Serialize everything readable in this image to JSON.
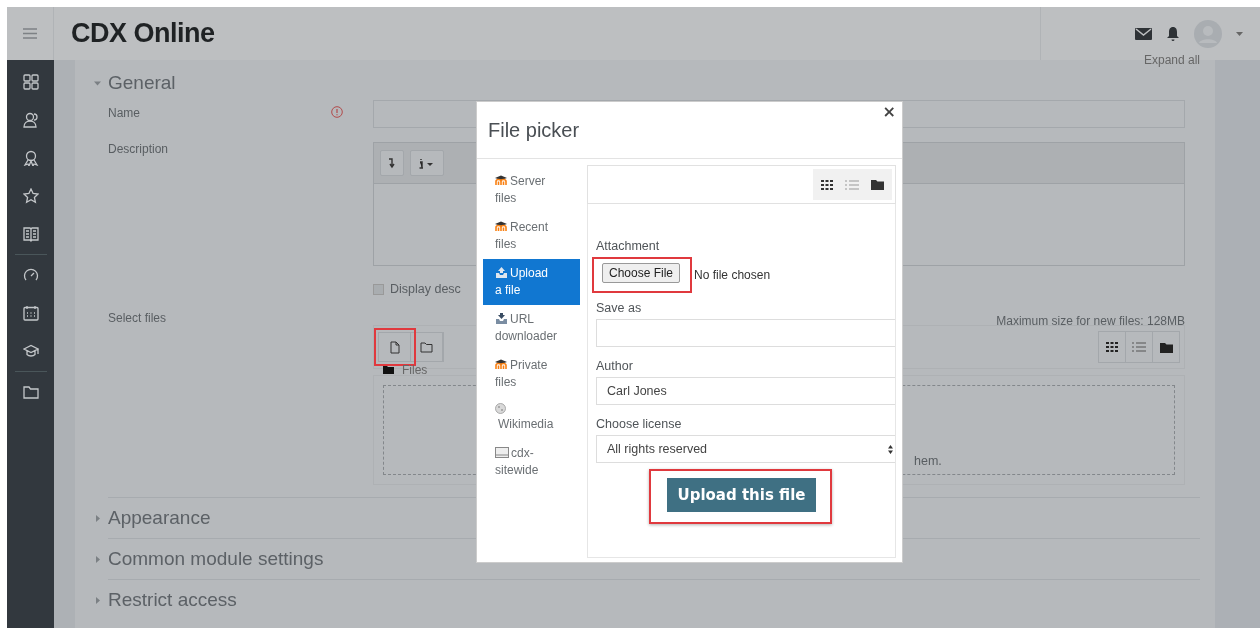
{
  "header": {
    "logo": "CDX Online"
  },
  "expand_all": "Expand all",
  "sections": [
    {
      "title": "General",
      "expanded": true
    },
    {
      "title": "Appearance",
      "expanded": false
    },
    {
      "title": "Common module settings",
      "expanded": false
    },
    {
      "title": "Restrict access",
      "expanded": false
    }
  ],
  "name_field": {
    "label": "Name",
    "required": true
  },
  "description": {
    "label": "Description",
    "display_option": "Display desc",
    "checked": false
  },
  "select_files": {
    "label": "Select files",
    "max_size": "Maximum size for new files: 128MB",
    "path": "Files",
    "drop_hint": "hem.",
    "add_highlighted": true
  },
  "dialog": {
    "title": "File picker",
    "close": "×",
    "repositories": [
      {
        "label": "Server files",
        "kind": "moodle",
        "selected": false
      },
      {
        "label": "Recent files",
        "kind": "moodle",
        "selected": false
      },
      {
        "label": "Upload a file",
        "kind": "upload",
        "selected": true
      },
      {
        "label": "URL downloader",
        "kind": "url",
        "selected": false
      },
      {
        "label": "Private files",
        "kind": "moodle",
        "selected": false
      },
      {
        "label": "Wikimedia",
        "kind": "wiki",
        "selected": false
      },
      {
        "label": "cdx-sitewide",
        "kind": "drive",
        "selected": false
      }
    ],
    "attachment_label": "Attachment",
    "choose_button": "Choose File",
    "choose_highlighted": true,
    "no_file": "No file chosen",
    "save_as_label": "Save as",
    "author_label": "Author",
    "author_value": "Carl Jones",
    "license_label": "Choose license",
    "license_value": "All rights reserved",
    "upload_button": "Upload this file",
    "upload_highlighted": true
  }
}
